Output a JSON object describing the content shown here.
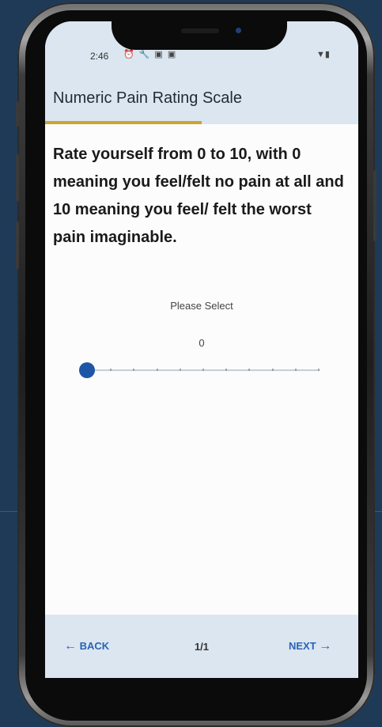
{
  "status_bar": {
    "time": "2:46",
    "icons": [
      "alarm-icon",
      "wrench-icon",
      "card-icon",
      "card-icon"
    ],
    "right_icons": [
      "wifi-icon",
      "battery-icon"
    ]
  },
  "header": {
    "title": "Numeric Pain Rating Scale",
    "progress": 0.5
  },
  "question": {
    "text": "Rate yourself from 0 to 10, with 0 meaning you feel/felt no pain at all and 10 meaning you feel/ felt the worst pain imaginable."
  },
  "slider": {
    "prompt": "Please Select",
    "value": "0",
    "min": 0,
    "max": 10
  },
  "footer": {
    "back_label": "BACK",
    "page_indicator": "1/1",
    "next_label": "NEXT"
  },
  "colors": {
    "accent": "#1e56a6",
    "progress": "#c9a62a",
    "header_bg": "#dbe6f0",
    "page_bg": "#1f3a57"
  }
}
